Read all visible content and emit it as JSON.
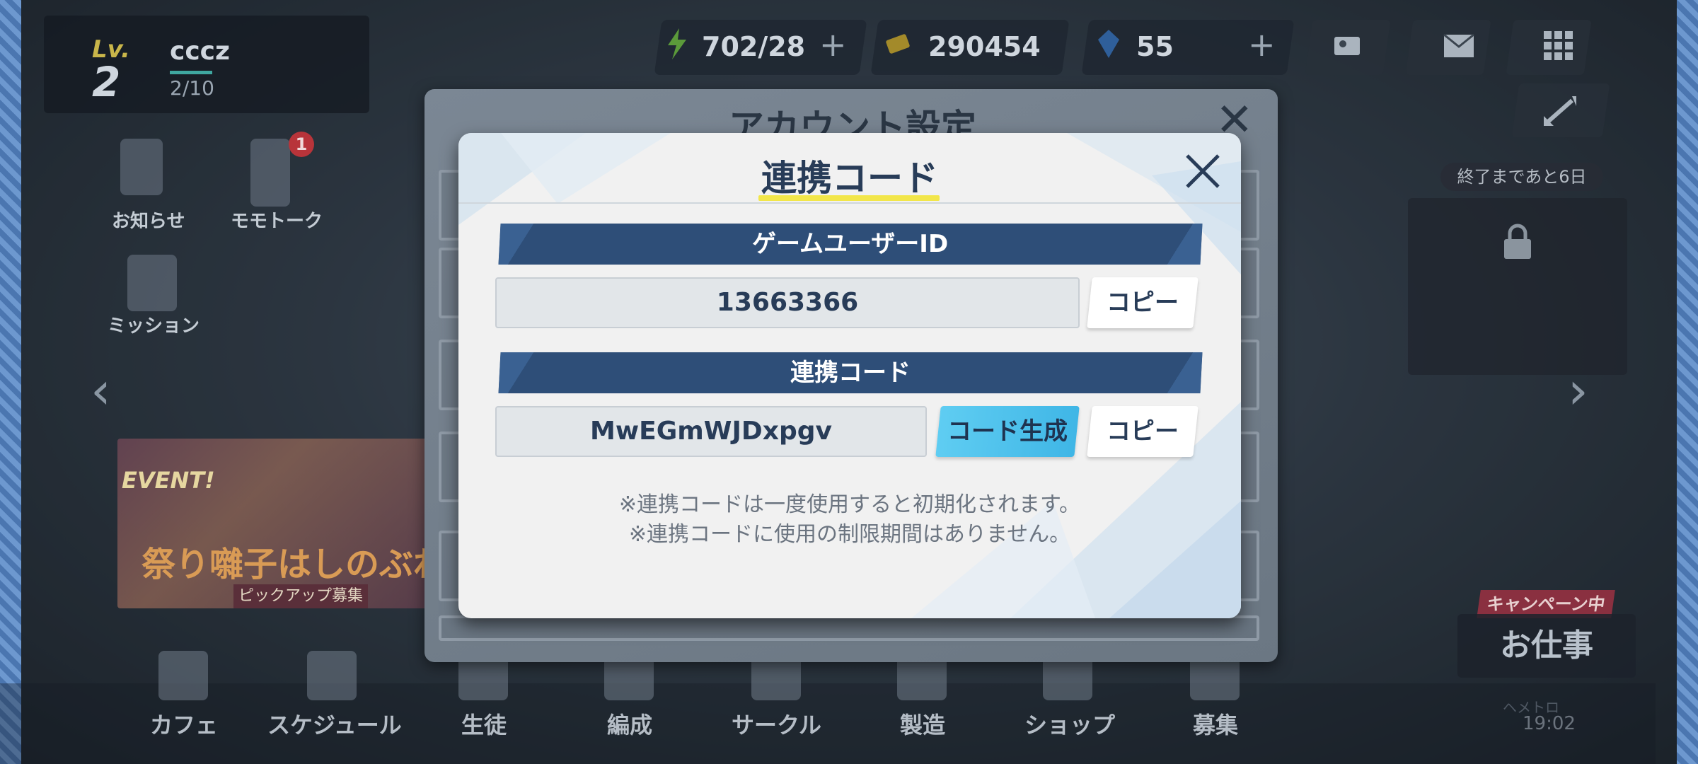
{
  "hud": {
    "level_label": "Lv.",
    "level": "2",
    "player_name": "cccz",
    "xp": "2/10",
    "stamina": "702/28",
    "credits": "290454",
    "gems": "55",
    "plus": "+"
  },
  "side": {
    "news": "お知らせ",
    "momotalk": "モモトーク",
    "momotalk_badge": "1",
    "mission": "ミッション",
    "event_word": "EVENT!",
    "event_title": "祭り囃子はしのぶれど",
    "event_sub": "ピックアップ募集",
    "timer": "終了まであと6日",
    "campaign": "キャンペーン中",
    "work": "お仕事",
    "clock": "19:02",
    "clock_sub": "ヘメトロ"
  },
  "bottom_nav": [
    {
      "label": "カフェ"
    },
    {
      "label": "スケジュール"
    },
    {
      "label": "生徒"
    },
    {
      "label": "編成"
    },
    {
      "label": "サークル"
    },
    {
      "label": "製造"
    },
    {
      "label": "ショップ"
    },
    {
      "label": "募集"
    }
  ],
  "back_dialog": {
    "title": "アカウント設定"
  },
  "dialog": {
    "title": "連携コード",
    "user_id_header": "ゲームユーザーID",
    "user_id": "13663366",
    "copy_label": "コピー",
    "code_header": "連携コード",
    "code": "MwEGmWJDxpgv",
    "generate_label": "コード生成",
    "note1": "※連携コードは一度使用すると初期化されます。",
    "note2": "※連携コードに使用の制限期間はありません。"
  },
  "colors": {
    "header_blue": "#2e4e78",
    "generate_blue": "#4fc2ee",
    "title_underline": "#f2e64a",
    "text_navy": "#283c58"
  }
}
